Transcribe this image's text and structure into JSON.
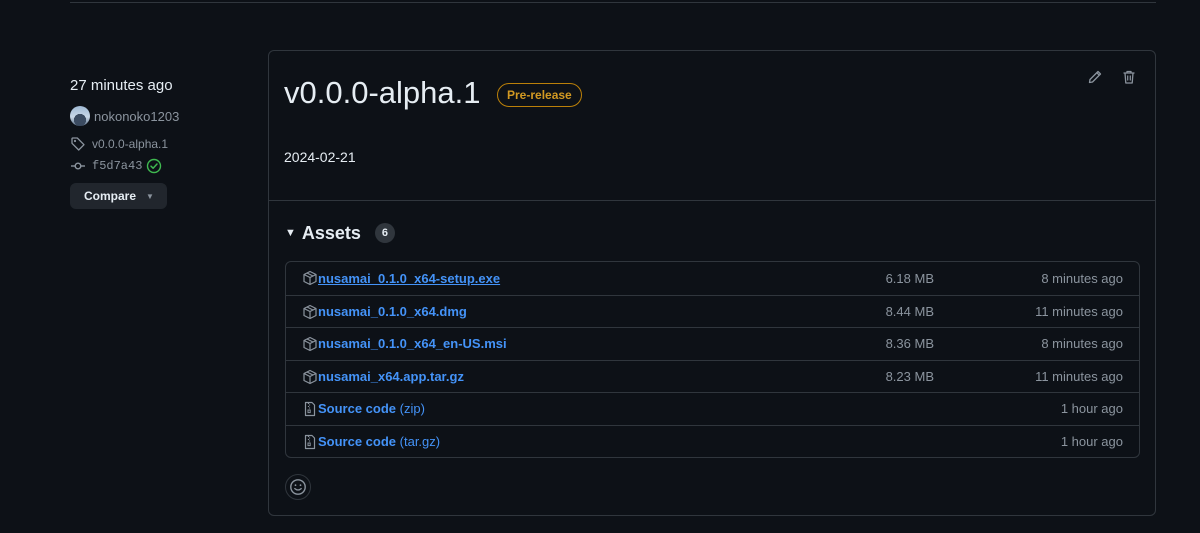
{
  "release": {
    "relative_time": "27 minutes ago",
    "author": "nokonoko1203",
    "tag": "v0.0.0-alpha.1",
    "commit": "f5d7a43",
    "compare_label": "Compare",
    "title": "v0.0.0-alpha.1",
    "badge": "Pre-release",
    "body": "2024-02-21"
  },
  "assets": {
    "label": "Assets",
    "count": "6",
    "items": [
      {
        "name": "nusamai_0.1.0_x64-setup.exe",
        "suffix": "",
        "size": "6.18 MB",
        "time": "8 minutes ago",
        "icon": "package-icon"
      },
      {
        "name": "nusamai_0.1.0_x64.dmg",
        "suffix": "",
        "size": "8.44 MB",
        "time": "11 minutes ago",
        "icon": "package-icon"
      },
      {
        "name": "nusamai_0.1.0_x64_en-US.msi",
        "suffix": "",
        "size": "8.36 MB",
        "time": "8 minutes ago",
        "icon": "package-icon"
      },
      {
        "name": "nusamai_x64.app.tar.gz",
        "suffix": "",
        "size": "8.23 MB",
        "time": "11 minutes ago",
        "icon": "package-icon"
      },
      {
        "name": "Source code",
        "suffix": " (zip)",
        "size": "",
        "time": "1 hour ago",
        "icon": "file-zip-icon"
      },
      {
        "name": "Source code",
        "suffix": " (tar.gz)",
        "size": "",
        "time": "1 hour ago",
        "icon": "file-zip-icon"
      }
    ]
  },
  "colors": {
    "background": "#0d1117",
    "border": "#30363d",
    "link": "#4493f8",
    "muted": "#8b949e",
    "prerelease": "#d29922",
    "success": "#3fb950"
  }
}
